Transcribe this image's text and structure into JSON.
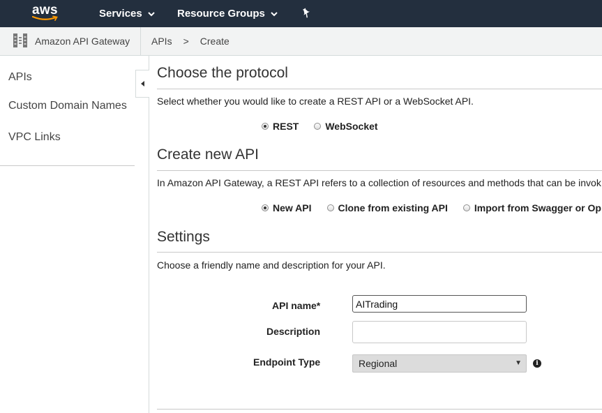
{
  "topnav": {
    "logo_text": "aws",
    "services_label": "Services",
    "resource_groups_label": "Resource Groups",
    "chevron_icon": "chevron-down-icon",
    "pin_icon": "pin-icon"
  },
  "subbar": {
    "service_name": "Amazon API Gateway",
    "service_icon": "api-gateway-icon",
    "breadcrumb": [
      "APIs",
      ">",
      "Create"
    ]
  },
  "sidebar": {
    "items": [
      {
        "label": "APIs"
      },
      {
        "label": "Custom Domain Names"
      },
      {
        "label": "VPC Links"
      }
    ],
    "collapse_icon": "caret-left-icon"
  },
  "protocol": {
    "title": "Choose the protocol",
    "description": "Select whether you would like to create a REST API or a WebSocket API.",
    "options": [
      {
        "label": "REST",
        "selected": true
      },
      {
        "label": "WebSocket",
        "selected": false
      }
    ]
  },
  "create_api": {
    "title": "Create new API",
    "description": "In Amazon API Gateway, a REST API refers to a collection of resources and methods that can be invok",
    "options": [
      {
        "label": "New API",
        "selected": true
      },
      {
        "label": "Clone from existing API",
        "selected": false
      },
      {
        "label": "Import from Swagger or Op",
        "selected": false
      }
    ]
  },
  "settings": {
    "title": "Settings",
    "description": "Choose a friendly name and description for your API.",
    "api_name_label": "API name*",
    "api_name_value": "AITrading",
    "description_label": "Description",
    "description_value": "",
    "endpoint_label": "Endpoint Type",
    "endpoint_value": "Regional",
    "info_icon": "info-icon",
    "info_glyph": "i"
  },
  "colors": {
    "topnav_bg": "#232f3e",
    "subbar_bg": "#f2f3f3",
    "select_bg": "#dcdcdc"
  }
}
